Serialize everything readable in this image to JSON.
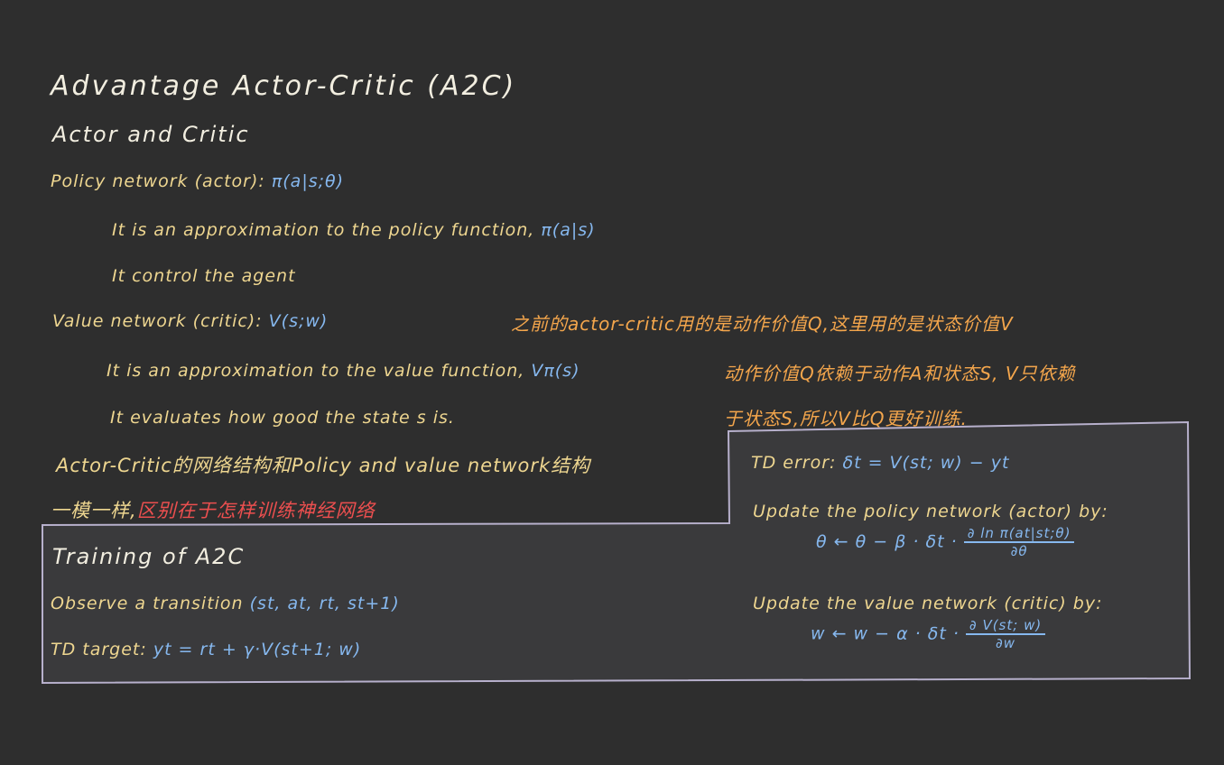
{
  "title": "Advantage Actor-Critic (A2C)",
  "subtitle": "Actor and Critic",
  "policy": {
    "label": "Policy network (actor):",
    "formula": "π(a|s;θ)",
    "line1": "It is an approximation to the policy function,",
    "line1_formula": "π(a|s)",
    "line2": "It control the agent"
  },
  "value": {
    "label": "Value network (critic):",
    "formula": "V(s;w)",
    "line1": "It is an approximation to the value function,",
    "line1_formula": "Vπ(s)",
    "line2": "It evaluates how good the state s is."
  },
  "note_orange": {
    "line1": "之前的actor-critic用的是动作价值Q,这里用的是状态价值V",
    "line2": "动作价值Q依赖于动作A和状态S, V只依赖",
    "line3": "于状态S,所以V比Q更好训练."
  },
  "structure_note": {
    "line1": "Actor-Critic的网络结构和Policy and value network结构",
    "line2_prefix": "一模一样,",
    "line2_red": "区别在于怎样训练神经网络"
  },
  "training": {
    "title": "Training of A2C",
    "observe_label": "Observe a transition",
    "observe_formula": "(st, at, rt, st+1)",
    "td_target_label": "TD target:",
    "td_target_formula": "yt = rt + γ·V(st+1; w)"
  },
  "updates": {
    "td_error_label": "TD error:",
    "td_error_formula": "δt = V(st; w) − yt",
    "policy_label": "Update the policy network (actor) by:",
    "policy_lhs": "θ ← θ − β · δt ·",
    "policy_num": "∂ ln π(at|st;θ)",
    "policy_den": "∂θ",
    "value_label": "Update the value network (critic) by:",
    "value_lhs": "w ← w − α · δt ·",
    "value_num": "∂ V(st; w)",
    "value_den": "∂w"
  },
  "colors": {
    "background": "#2e2e2e",
    "white": "#f2eee0",
    "yellow": "#eed690",
    "blue": "#86b8ef",
    "orange": "#f4a64c",
    "red": "#ec4f4f",
    "frame": "#b7b0cc"
  }
}
